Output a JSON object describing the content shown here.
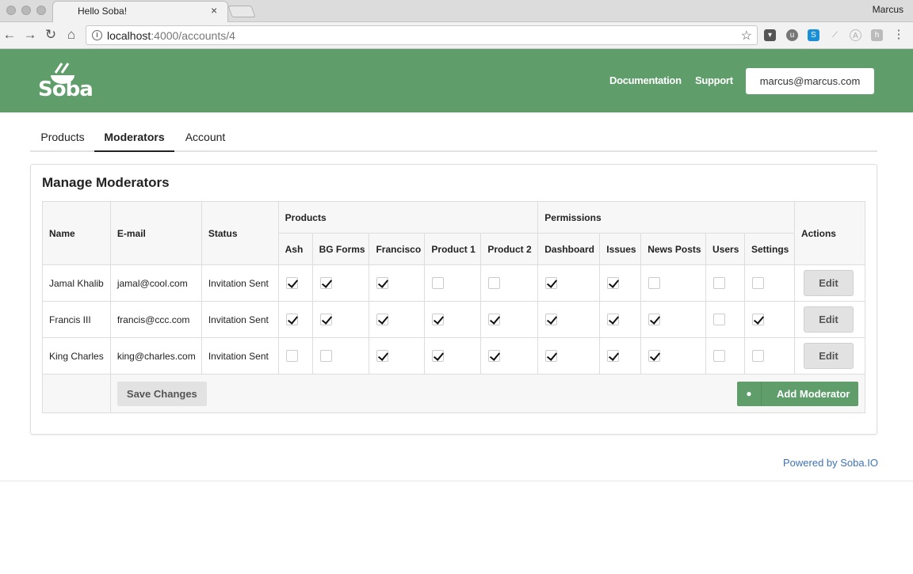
{
  "browser": {
    "tab_title": "Hello Soba!",
    "tab_close": "×",
    "profile_name": "Marcus",
    "url_host": "localhost",
    "url_path": ":4000/accounts/4"
  },
  "header": {
    "logo_text": "Soba",
    "links": [
      "Documentation",
      "Support"
    ],
    "user_email": "marcus@marcus.com",
    "brand_color": "#5f9e6b"
  },
  "tabs": [
    "Products",
    "Moderators",
    "Account"
  ],
  "active_tab": "Moderators",
  "panel": {
    "title": "Manage Moderators"
  },
  "table": {
    "columns": {
      "name": "Name",
      "email": "E-mail",
      "status": "Status",
      "products_group": "Products",
      "permissions_group": "Permissions",
      "actions": "Actions"
    },
    "products": [
      "Ash",
      "BG Forms",
      "Francisco",
      "Product 1",
      "Product 2"
    ],
    "permissions": [
      "Dashboard",
      "Issues",
      "News Posts",
      "Users",
      "Settings"
    ],
    "rows": [
      {
        "name": "Jamal Khalib",
        "email": "jamal@cool.com",
        "status": "Invitation Sent",
        "products": [
          true,
          true,
          true,
          false,
          false
        ],
        "permissions": [
          true,
          true,
          false,
          false,
          false
        ],
        "action": "Edit"
      },
      {
        "name": "Francis III",
        "email": "francis@ccc.com",
        "status": "Invitation Sent",
        "products": [
          true,
          true,
          true,
          true,
          true
        ],
        "permissions": [
          true,
          true,
          true,
          false,
          true
        ],
        "action": "Edit"
      },
      {
        "name": "King Charles",
        "email": "king@charles.com",
        "status": "Invitation Sent",
        "products": [
          false,
          false,
          true,
          true,
          true
        ],
        "permissions": [
          true,
          true,
          true,
          false,
          false
        ],
        "action": "Edit"
      }
    ],
    "save_label": "Save Changes",
    "add_label": "Add Moderator"
  },
  "footer": {
    "powered_by": "Powered by Soba.IO",
    "link_color": "#3d72b8"
  }
}
